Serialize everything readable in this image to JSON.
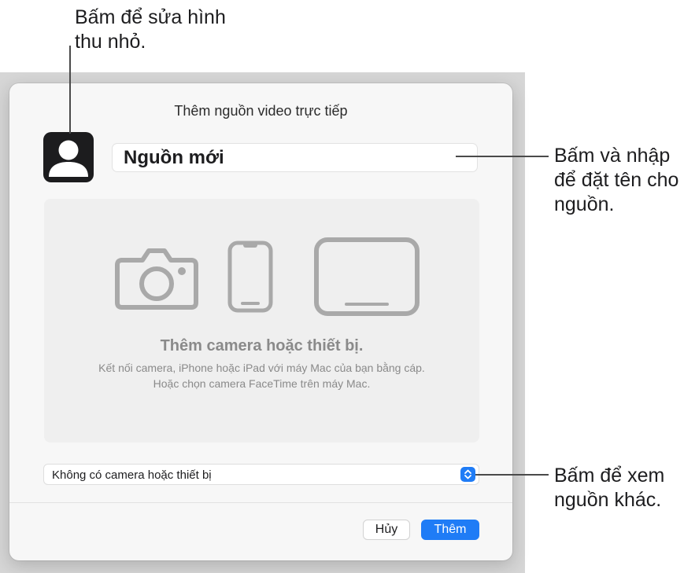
{
  "callouts": {
    "thumbnail": "Bấm để sửa hình thu nhỏ.",
    "name": "Bấm và nhập để đặt tên cho nguồn.",
    "source": "Bấm để xem nguồn khác."
  },
  "dialog": {
    "title": "Thêm nguồn video trực tiếp",
    "thumbnail_icon": "person-silhouette-icon",
    "name_value": "Nguồn mới",
    "drop_area": {
      "icons": [
        "camera-icon",
        "iphone-icon",
        "ipad-icon"
      ],
      "title": "Thêm camera hoặc thiết bị.",
      "description": "Kết nối camera, iPhone hoặc iPad với máy Mac của bạn bằng cáp. Hoặc chọn camera FaceTime trên máy Mac."
    },
    "source_select": {
      "value": "Không có camera hoặc thiết bị",
      "icon": "up-down-chevron-icon"
    },
    "buttons": {
      "cancel": "Hủy",
      "add": "Thêm"
    }
  },
  "colors": {
    "accent": "#1f7cf6",
    "device_icons": "#a9a9a9",
    "dialog_background": "#f7f7f7"
  }
}
